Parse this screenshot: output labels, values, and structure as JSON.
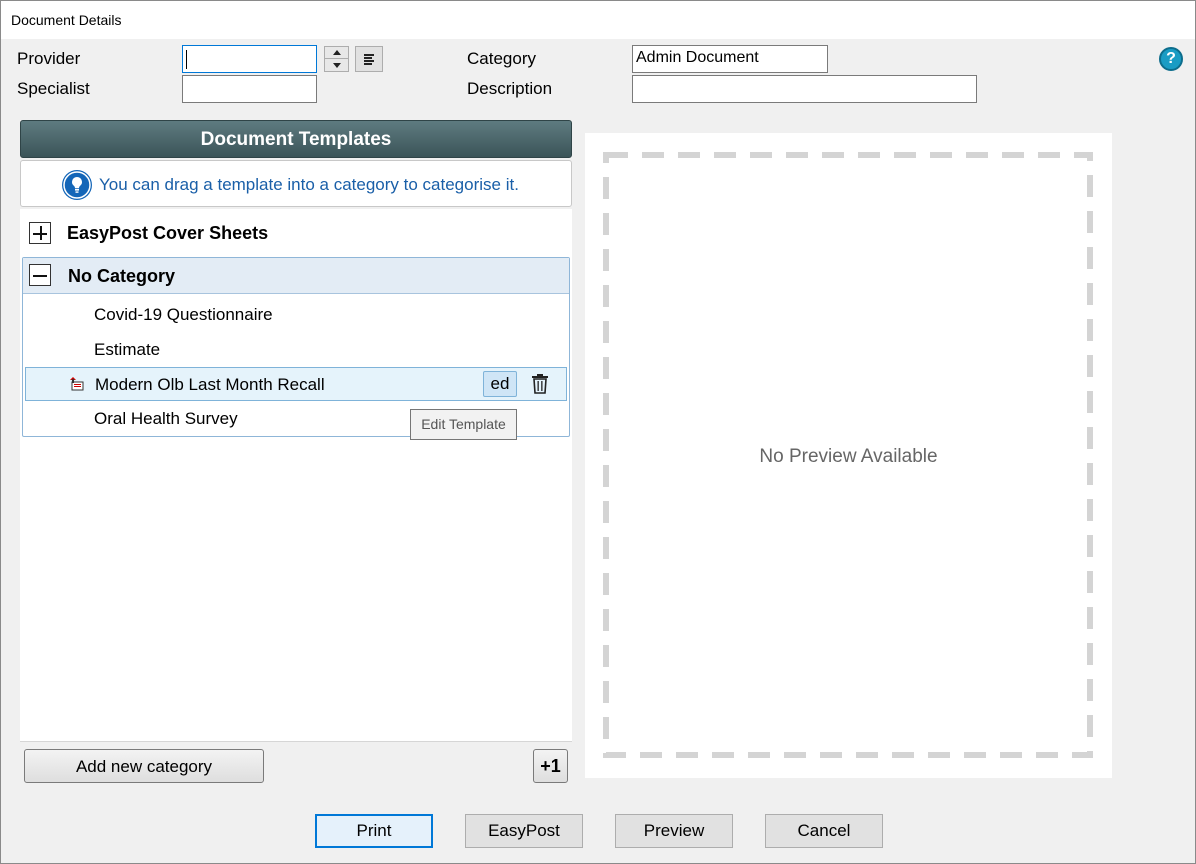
{
  "window": {
    "title": "Document Details"
  },
  "form": {
    "provider_label": "Provider",
    "provider_value": "",
    "specialist_label": "Specialist",
    "specialist_value": "",
    "category_label": "Category",
    "category_value": "Admin Document",
    "description_label": "Description",
    "description_value": ""
  },
  "help": {
    "glyph": "?"
  },
  "templates": {
    "header": "Document Templates",
    "hint": "You can drag a template into a category to categorise it.",
    "categories": [
      {
        "name": "EasyPost Cover Sheets",
        "expanded": false,
        "items": []
      },
      {
        "name": "No Category",
        "expanded": true,
        "items": [
          {
            "name": "Covid-19 Questionnaire"
          },
          {
            "name": "Estimate"
          },
          {
            "name": "Modern Olb Last Month Recall",
            "selected": true,
            "edit_label": "ed"
          },
          {
            "name": "Oral Health Survey"
          }
        ]
      }
    ],
    "tooltip": "Edit Template",
    "add_category_label": "Add new category",
    "plus_one_label": "+1"
  },
  "preview": {
    "empty_text": "No Preview Available"
  },
  "actions": {
    "print": "Print",
    "easypost": "EasyPost",
    "preview": "Preview",
    "cancel": "Cancel"
  },
  "colors": {
    "header_bg": "#4a6569",
    "hint_text": "#1a5fa8",
    "selection_bg": "#e5f3fb",
    "help_icon": "#1a9cc4"
  }
}
